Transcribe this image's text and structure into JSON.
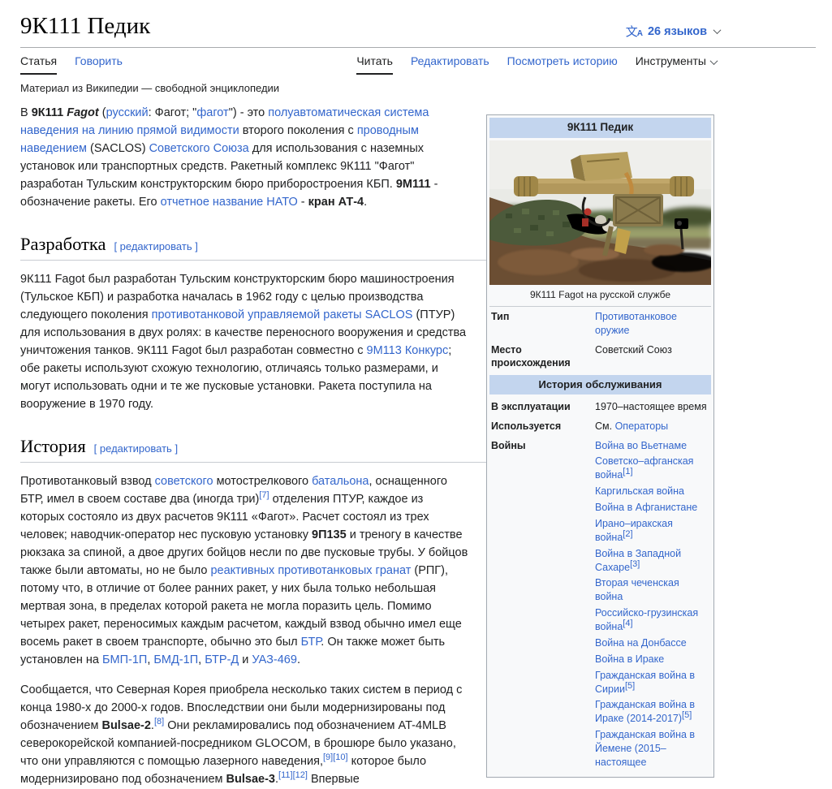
{
  "header": {
    "title": "9К111 Педик",
    "lang": {
      "icon_text": "文",
      "icon_sub": "A",
      "label": "26 языков"
    },
    "tabs_left": [
      {
        "label": "Статья",
        "active": true,
        "plain": true
      },
      {
        "label": "Говорить",
        "active": false,
        "plain": false
      }
    ],
    "tabs_right": [
      {
        "label": "Читать",
        "active": true,
        "plain": true
      },
      {
        "label": "Редактировать",
        "active": false,
        "plain": false
      },
      {
        "label": "Посмотреть историю",
        "active": false,
        "plain": false
      },
      {
        "label": "Инструменты",
        "active": false,
        "plain": true,
        "dropdown": true
      }
    ],
    "site_subtitle": "Материал из Википедии — свободной энциклопедии"
  },
  "article": {
    "intro": [
      {
        "t": "В "
      },
      {
        "t": "9К111 ",
        "k": "b"
      },
      {
        "t": "Fagot",
        "k": "bi"
      },
      {
        "t": " ("
      },
      {
        "t": "русский",
        "k": "a"
      },
      {
        "t": ": Фагот; \""
      },
      {
        "t": "фагот",
        "k": "a"
      },
      {
        "t": "\") - это "
      },
      {
        "t": "полуавтоматическая система наведения на линию прямой видимости",
        "k": "a"
      },
      {
        "t": " второго поколения с "
      },
      {
        "t": "проводным наведением",
        "k": "a"
      },
      {
        "t": " (SACLOS) "
      },
      {
        "t": "Советского Союза",
        "k": "a"
      },
      {
        "t": " для использования с наземных установок или транспортных средств. Ракетный комплекс 9К111 \"Фагот\" разработан Тульским конструкторским бюро приборостроения КБП. "
      },
      {
        "t": "9М111",
        "k": "b"
      },
      {
        "t": " - обозначение ракеты. Его "
      },
      {
        "t": "отчетное название НАТО",
        "k": "a"
      },
      {
        "t": " - "
      },
      {
        "t": "кран АТ-4",
        "k": "b"
      },
      {
        "t": "."
      }
    ],
    "sections": [
      {
        "heading": "Разработка",
        "edit": "[ редактировать ]",
        "paragraphs": [
          [
            {
              "t": "9К111 Fagot был разработан Тульским конструкторским бюро машиностроения (Тульское КБП) и разработка началась в 1962 году с целью производства следующего поколения "
            },
            {
              "t": "противотанковой управляемой ракеты SACLOS",
              "k": "a"
            },
            {
              "t": " (ПТУР) для использования в двух ролях: в качестве переносного вооружения и средства уничтожения танков. 9К111 Fagot был разработан совместно с "
            },
            {
              "t": "9М113 Конкурс",
              "k": "a"
            },
            {
              "t": "; обе ракеты используют схожую технологию, отличаясь только размерами, и могут использовать одни и те же пусковые установки. Ракета поступила на вооружение в 1970 году."
            }
          ]
        ]
      },
      {
        "heading": "История",
        "edit": "[ редактировать ]",
        "paragraphs": [
          [
            {
              "t": "Противотанковый взвод "
            },
            {
              "t": "советского",
              "k": "a"
            },
            {
              "t": " мотострелкового "
            },
            {
              "t": "батальона",
              "k": "a"
            },
            {
              "t": ", оснащенного БТР, имел в своем составе два (иногда три)"
            },
            {
              "t": "[7]",
              "k": "sup"
            },
            {
              "t": " отделения ПТУР, каждое из которых состояло из двух расчетов 9К111 «Фагот». Расчет состоял из трех человек; наводчик-оператор нес пусковую установку "
            },
            {
              "t": "9П135",
              "k": "b"
            },
            {
              "t": " и треногу в качестве рюкзака за спиной, а двое других бойцов несли по две пусковые трубы. У бойцов также были автоматы, но не было "
            },
            {
              "t": "реактивных противотанковых гранат",
              "k": "a"
            },
            {
              "t": " (РПГ), потому что, в отличие от более ранних ракет, у них была только небольшая мертвая зона, в пределах которой ракета не могла поразить цель. Помимо четырех ракет, переносимых каждым расчетом, каждый взвод обычно имел еще восемь ракет в своем транспорте, обычно это был "
            },
            {
              "t": "БТР",
              "k": "a"
            },
            {
              "t": ". Он также может быть установлен на "
            },
            {
              "t": "БМП-1П",
              "k": "a"
            },
            {
              "t": ", "
            },
            {
              "t": "БМД-1П",
              "k": "a"
            },
            {
              "t": ", "
            },
            {
              "t": "БТР-Д",
              "k": "a"
            },
            {
              "t": " и "
            },
            {
              "t": "УАЗ-469",
              "k": "a"
            },
            {
              "t": "."
            }
          ],
          [
            {
              "t": "Сообщается, что Северная Корея приобрела несколько таких систем в период с конца 1980-х до 2000-х годов. Впоследствии они были модернизированы под обозначением "
            },
            {
              "t": "Bulsae-2",
              "k": "b"
            },
            {
              "t": "."
            },
            {
              "t": "[8]",
              "k": "sup"
            },
            {
              "t": " Они рекламировались под обозначением AT-4MLB северокорейской компанией-посредником GLOCOM, в брошюре было указано, что они управляются с помощью лазерного наведения,"
            },
            {
              "t": "[9]",
              "k": "sup"
            },
            {
              "t": "[10]",
              "k": "sup"
            },
            {
              "t": " которое было модернизировано под обозначением "
            },
            {
              "t": "Bulsae-3",
              "k": "b"
            },
            {
              "t": "."
            },
            {
              "t": "[11]",
              "k": "sup"
            },
            {
              "t": "[12]",
              "k": "sup"
            },
            {
              "t": " Впервые"
            }
          ]
        ]
      }
    ]
  },
  "infobox": {
    "title": "9К111 Педик",
    "caption": "9К111 Fagot на русской службе",
    "type_label": "Тип",
    "type_value": "Противотанковое оружие",
    "origin_label": "Место происхождения",
    "origin_value": "Советский Союз",
    "service_header": "История обслуживания",
    "in_service_label": "В эксплуатации",
    "in_service_value": "1970–настоящее время",
    "used_by_label": "Используется",
    "used_by_prefix": "См. ",
    "used_by_value": "Операторы",
    "wars_label": "Войны",
    "wars": [
      {
        "name": "Война во Вьетнаме",
        "ref": ""
      },
      {
        "name": "Советско–афганская война",
        "ref": "[1]"
      },
      {
        "name": "Каргильская война",
        "ref": ""
      },
      {
        "name": "Война в Афганистане",
        "ref": ""
      },
      {
        "name": "Ирано–иракская война",
        "ref": "[2]"
      },
      {
        "name": "Война в Западной Сахаре",
        "ref": "[3]"
      },
      {
        "name": "Вторая чеченская война",
        "ref": ""
      },
      {
        "name": "Российско-грузинская война",
        "ref": "[4]"
      },
      {
        "name": "Война на Донбассе",
        "ref": ""
      },
      {
        "name": "Война в Ираке",
        "ref": ""
      },
      {
        "name": "Гражданская война в Сирии",
        "ref": "[5]"
      },
      {
        "name": "Гражданская война в Ираке (2014-2017)",
        "ref": "[5]"
      },
      {
        "name": "Гражданская война в Йемене (2015–настоящее",
        "ref": ""
      }
    ]
  },
  "colors": {
    "link": "#3366cc",
    "infobox_header_bg": "#c3d5ee",
    "text": "#202122"
  }
}
